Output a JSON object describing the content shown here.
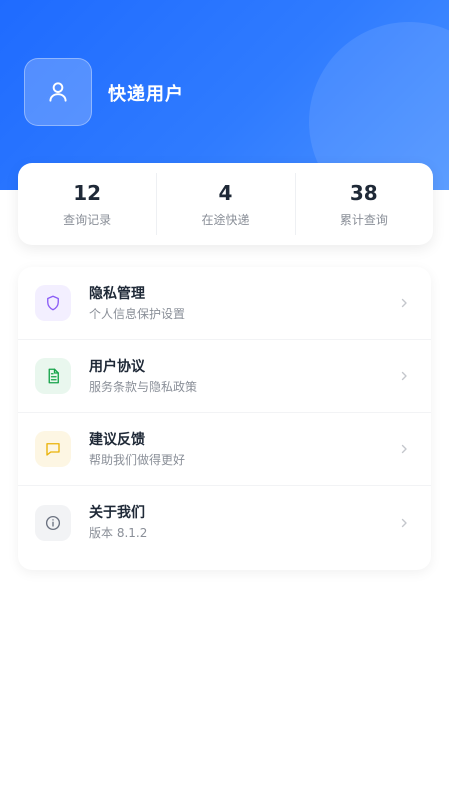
{
  "user": {
    "name": "快递用户",
    "avatar_icon": "user-icon"
  },
  "stats": [
    {
      "value": "12",
      "label": "查询记录"
    },
    {
      "value": "4",
      "label": "在途快递"
    },
    {
      "value": "38",
      "label": "累计查询"
    }
  ],
  "menu": [
    {
      "title": "隐私管理",
      "subtitle": "个人信息保护设置",
      "icon": "shield-icon",
      "color": "#8b5cf6"
    },
    {
      "title": "用户协议",
      "subtitle": "服务条款与隐私政策",
      "icon": "document-icon",
      "color": "#16a34a"
    },
    {
      "title": "建议反馈",
      "subtitle": "帮助我们做得更好",
      "icon": "chat-icon",
      "color": "#eab308"
    },
    {
      "title": "关于我们",
      "subtitle": "版本 8.1.2",
      "icon": "info-icon",
      "color": "#6b7280"
    }
  ],
  "colors": {
    "header_start": "#1f6bff",
    "header_end": "#4a92ff"
  }
}
